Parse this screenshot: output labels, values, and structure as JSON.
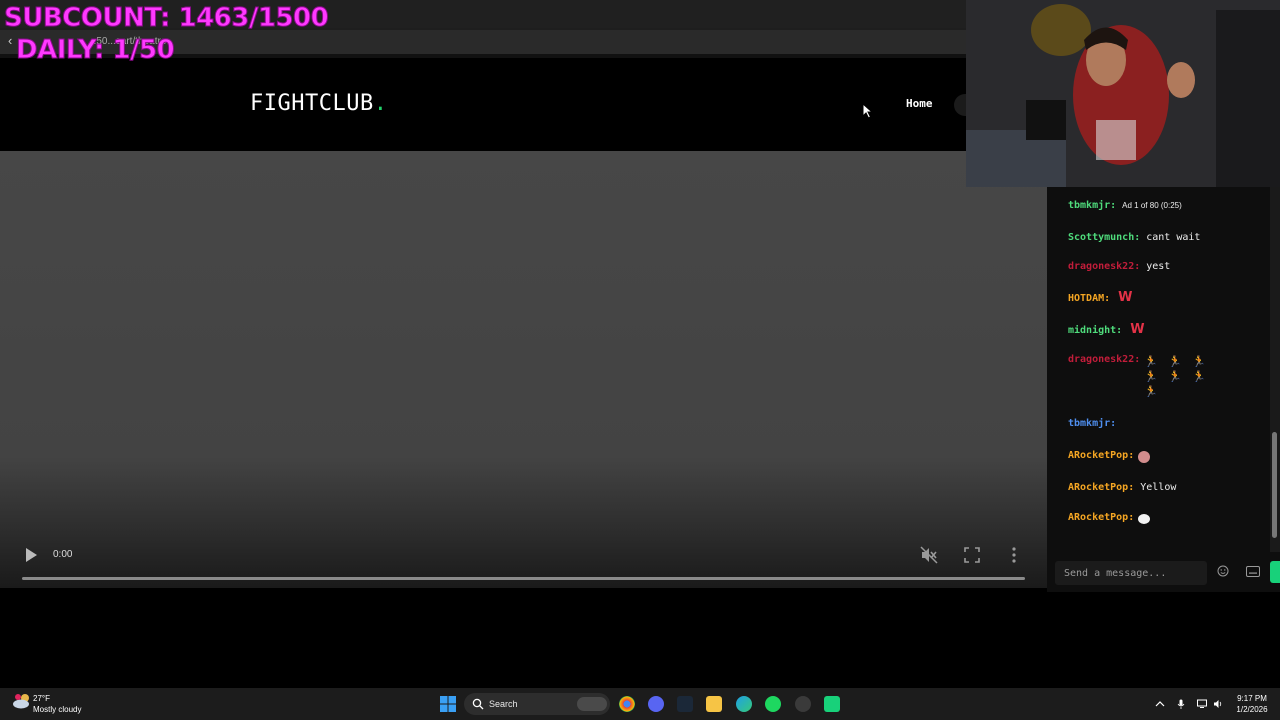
{
  "overlay": {
    "subcount": "SUBCOUNT: 1463/1500",
    "daily": "DAILY: 1/50"
  },
  "browser": {
    "url": "...50...sart/theatre"
  },
  "site": {
    "logo_text": "FIGHTCLUB",
    "logo_dot": ".",
    "nav_home": "Home",
    "accent_color": "#22d36b"
  },
  "video": {
    "time": "0:00",
    "progress": 0
  },
  "chat": {
    "messages": [
      {
        "user": "tbmkmjr:",
        "color": "#4fdc7c",
        "text": "Ad 1 of 80 (0:25)"
      },
      {
        "user": "Scottymunch:",
        "color": "#4fdc7c",
        "text": "cant wait"
      },
      {
        "user": "dragonesk22:",
        "color": "#c21d3a",
        "text": "yest"
      },
      {
        "user": "HOTDAM:",
        "color": "#f5a623",
        "text": "W"
      },
      {
        "user": "midnight:",
        "color": "#4fdc7c",
        "text": "W"
      },
      {
        "user": "dragonesk22:",
        "color": "#c21d3a",
        "text": ""
      },
      {
        "user": "tbmkmjr:",
        "color": "#4f8ff0",
        "text": ""
      },
      {
        "user": "ARocketPop:",
        "color": "#f5a623",
        "text": ""
      },
      {
        "user": "ARocketPop:",
        "color": "#f5a623",
        "text": "Yellow"
      },
      {
        "user": "ARocketPop:",
        "color": "#f5a623",
        "text": ""
      }
    ],
    "input_placeholder": "Send a message...",
    "send_color": "#18d17a"
  },
  "taskbar": {
    "temperature": "27°F",
    "weather": "Mostly cloudy",
    "search_label": "Search",
    "time": "9:17 PM",
    "date": "1/2/2026"
  }
}
